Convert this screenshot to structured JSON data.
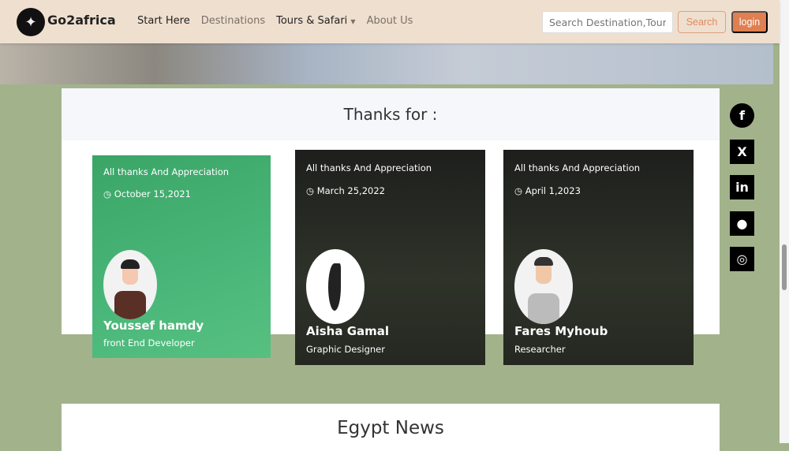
{
  "nav": {
    "brand": "Go2africa",
    "links": [
      "Start Here",
      "Destinations",
      "Tours & Safari",
      "About Us"
    ],
    "search_placeholder": "Search Destination,Tour",
    "search_label": "Search",
    "login_label": "login"
  },
  "thanks": {
    "title": "Thanks for :",
    "cards": [
      {
        "tag": "All thanks And Appreciation",
        "date": "October 15,2021",
        "name": "Youssef hamdy",
        "role": "front End Developer"
      },
      {
        "tag": "All thanks And Appreciation",
        "date": "March 25,2022",
        "name": "Aisha Gamal",
        "role": "Graphic Designer"
      },
      {
        "tag": "All thanks And Appreciation",
        "date": "April 1,2023",
        "name": "Fares Myhoub",
        "role": "Researcher"
      }
    ]
  },
  "social": [
    "facebook-icon",
    "x-icon",
    "linkedin-icon",
    "github-icon",
    "instagram-icon"
  ],
  "news": {
    "title": "Egypt News"
  }
}
